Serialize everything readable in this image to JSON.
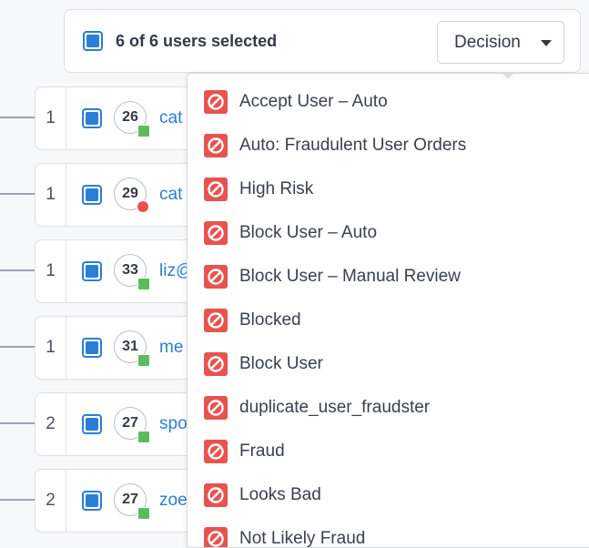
{
  "header": {
    "selection_text": "6 of 6 users selected",
    "decision_label": "Decision"
  },
  "rows": [
    {
      "count": "1",
      "score": "26",
      "status": "green",
      "user": "cat"
    },
    {
      "count": "1",
      "score": "29",
      "status": "red",
      "user": "cat"
    },
    {
      "count": "1",
      "score": "33",
      "status": "green",
      "user": "liz@"
    },
    {
      "count": "1",
      "score": "31",
      "status": "green",
      "user": "me"
    },
    {
      "count": "2",
      "score": "27",
      "status": "green",
      "user": "spo"
    },
    {
      "count": "2",
      "score": "27",
      "status": "green",
      "user": "zoe"
    }
  ],
  "dropdown": {
    "items": [
      {
        "label": "Accept User – Auto",
        "icon": "block-icon"
      },
      {
        "label": "Auto: Fraudulent User Orders",
        "icon": "block-icon"
      },
      {
        "label": "High Risk",
        "icon": "block-icon"
      },
      {
        "label": "Block User – Auto",
        "icon": "block-icon"
      },
      {
        "label": "Block User – Manual Review",
        "icon": "block-icon"
      },
      {
        "label": "Blocked",
        "icon": "block-icon"
      },
      {
        "label": "Block User",
        "icon": "block-icon"
      },
      {
        "label": "duplicate_user_fraudster",
        "icon": "block-icon"
      },
      {
        "label": "Fraud",
        "icon": "block-icon"
      },
      {
        "label": "Looks Bad",
        "icon": "block-icon"
      },
      {
        "label": "Not Likely Fraud",
        "icon": "block-icon"
      }
    ]
  },
  "colors": {
    "accent": "#2a7fd5",
    "danger": "#e8534f",
    "ok": "#5cbc5c"
  }
}
